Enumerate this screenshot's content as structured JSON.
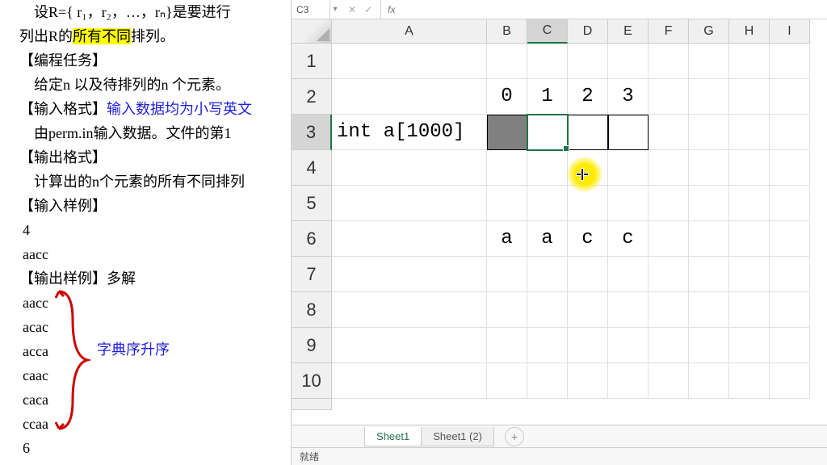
{
  "left": {
    "line1a": "设R={ r",
    "line1b": "₁，r",
    "line1c": "₂，…，r",
    "line1d": "ₙ}是要进行",
    "line2a": "列出R的",
    "line2_hl": "所有不同",
    "line2b": "排列。",
    "task_header": "【编程任务】",
    "task_body": "给定n 以及待排列的n 个元素。",
    "input_header": "【输入格式】",
    "input_link": "输入数据均为小写英文",
    "input_body": "由perm.in输入数据。文件的第1",
    "output_header": "【输出格式】",
    "output_body": "计算出的n个元素的所有不同排列",
    "sample_in_header": "【输入样例】",
    "sample_in_l1": "4",
    "sample_in_l2": "aacc",
    "sample_out_header": "【输出样例】多解",
    "out_items": [
      "aacc",
      "acac",
      "acca",
      "caac",
      "caca",
      "ccaa"
    ],
    "out_last": "6",
    "dict_order": "字典序升序"
  },
  "excel": {
    "namebox": "C3",
    "fx_check": "✓",
    "fx_x": "✕",
    "fx": "fx",
    "cols": [
      "A",
      "B",
      "C",
      "D",
      "E",
      "F",
      "G",
      "H",
      "I"
    ],
    "rows": [
      "1",
      "2",
      "3",
      "4",
      "5",
      "6",
      "7",
      "8",
      "9",
      "10"
    ],
    "row2": {
      "B": "0",
      "C": "1",
      "D": "2",
      "E": "3"
    },
    "row3": {
      "A": "int a[1000]"
    },
    "row6": {
      "B": "a",
      "C": "a",
      "D": "c",
      "E": "c"
    },
    "tabs": {
      "t1": "Sheet1",
      "t2": "Sheet1 (2)"
    },
    "add": "+",
    "status": "就绪"
  },
  "chart_data": {
    "type": "table",
    "title": "Spreadsheet cells",
    "columns": [
      "A",
      "B",
      "C",
      "D",
      "E",
      "F",
      "G",
      "H",
      "I"
    ],
    "rows": [
      {
        "r": 1
      },
      {
        "r": 2,
        "B": 0,
        "C": 1,
        "D": 2,
        "E": 3
      },
      {
        "r": 3,
        "A": "int a[1000]",
        "B": "(gray)",
        "C": "(selected)"
      },
      {
        "r": 4
      },
      {
        "r": 5
      },
      {
        "r": 6,
        "B": "a",
        "C": "a",
        "D": "c",
        "E": "c"
      },
      {
        "r": 7
      },
      {
        "r": 8
      },
      {
        "r": 9
      },
      {
        "r": 10
      }
    ],
    "active_cell": "C3"
  }
}
